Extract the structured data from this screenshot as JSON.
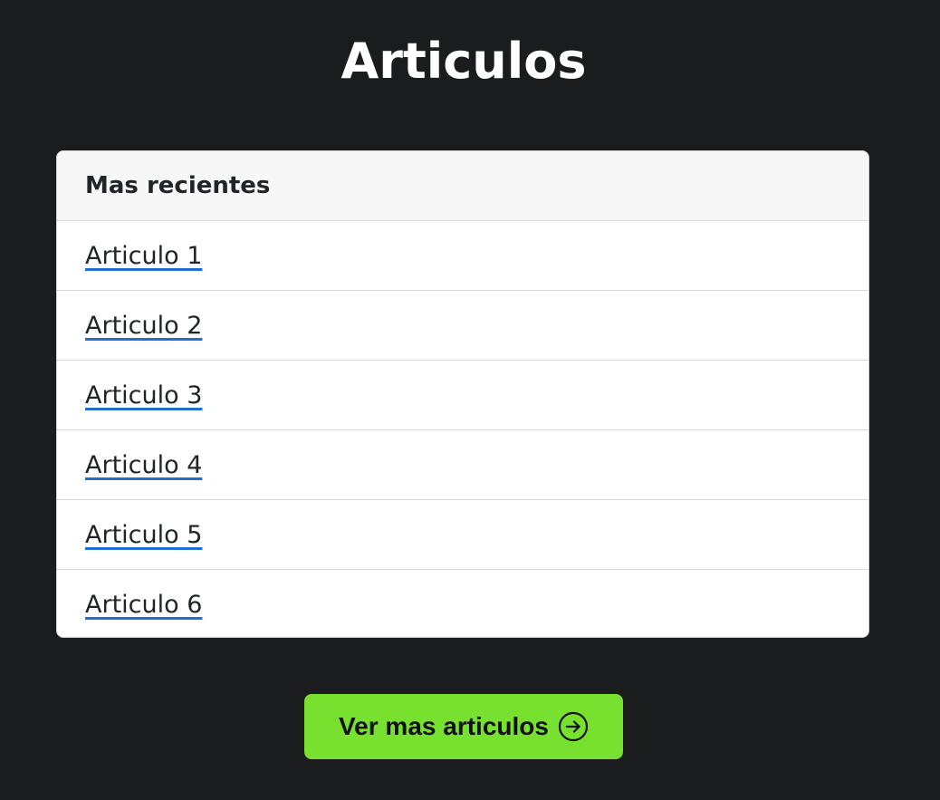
{
  "page": {
    "title": "Articulos",
    "background_color": "#1b1c1e"
  },
  "card": {
    "header": "Mas recientes",
    "articles": [
      {
        "label": "Articulo 1"
      },
      {
        "label": "Articulo 2"
      },
      {
        "label": "Articulo 3"
      },
      {
        "label": "Articulo 4"
      },
      {
        "label": "Articulo 5"
      },
      {
        "label": "Articulo 6"
      }
    ],
    "link_underline_color": "#1f6fce"
  },
  "more_button": {
    "label": "Ver mas articulos",
    "icon": "arrow-right-circle-icon",
    "color": "#78e02e"
  }
}
